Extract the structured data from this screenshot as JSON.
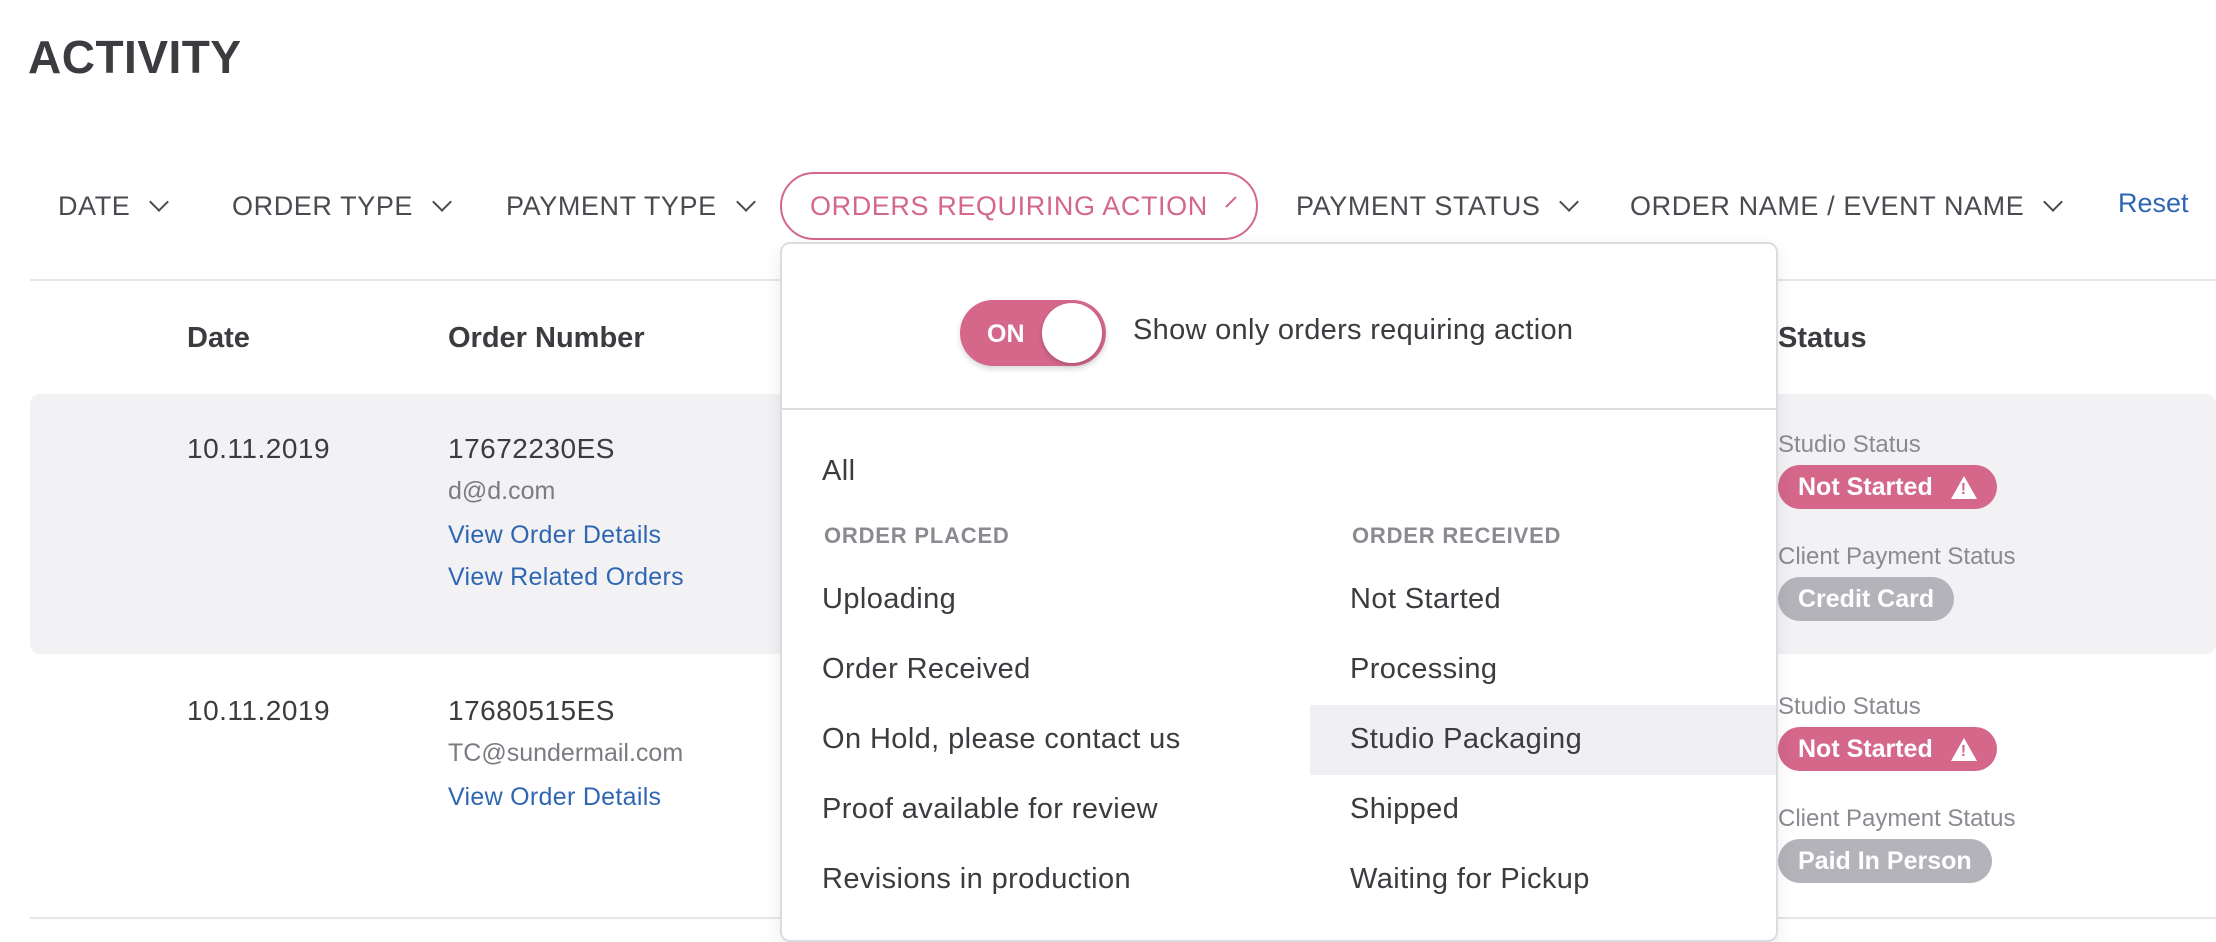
{
  "page": {
    "title": "ACTIVITY"
  },
  "filters": {
    "date": "DATE",
    "order_type": "ORDER TYPE",
    "payment_type": "PAYMENT TYPE",
    "orders_requiring_action": "ORDERS REQUIRING ACTION",
    "payment_status": "PAYMENT STATUS",
    "order_name": "ORDER NAME / EVENT NAME",
    "reset": "Reset"
  },
  "table": {
    "headers": {
      "date": "Date",
      "order_number": "Order Number",
      "status": "Status"
    },
    "rows": [
      {
        "date": "10.11.2019",
        "order_number": "17672230ES",
        "email": "d@d.com",
        "links": [
          "View Order Details",
          "View Related Orders"
        ],
        "studio_status_label": "Studio Status",
        "studio_status": "Not Started",
        "client_payment_label": "Client Payment Status",
        "client_payment": "Credit Card"
      },
      {
        "date": "10.11.2019",
        "order_number": "17680515ES",
        "email": "TC@sundermail.com",
        "links": [
          "View Order Details"
        ],
        "studio_status_label": "Studio Status",
        "studio_status": "Not Started",
        "client_payment_label": "Client Payment Status",
        "client_payment": "Paid In Person"
      }
    ]
  },
  "dropdown": {
    "toggle_state": "ON",
    "toggle_label": "Show only orders requiring action",
    "all": "All",
    "groups": [
      {
        "name": "ORDER PLACED",
        "options": [
          "Uploading",
          "Order Received",
          "On Hold, please contact us",
          "Proof available for review",
          "Revisions in production"
        ]
      },
      {
        "name": "ORDER RECEIVED",
        "options": [
          "Not Started",
          "Processing",
          "Studio Packaging",
          "Shipped",
          "Waiting for Pickup"
        ]
      }
    ],
    "hovered_option": "Studio Packaging"
  },
  "colors": {
    "accent": "#d4678a",
    "link": "#2f66b3",
    "badge_gray": "#b3b3b9"
  }
}
